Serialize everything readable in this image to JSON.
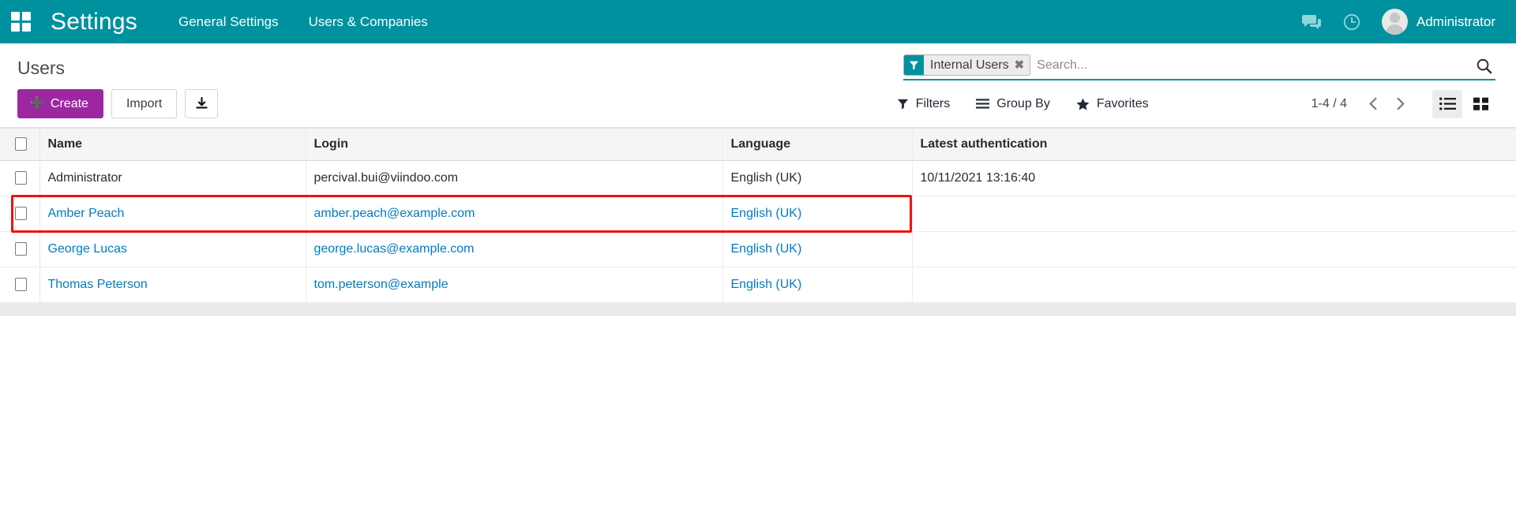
{
  "navbar": {
    "apps_icon": "apps-grid-icon",
    "brand": "Settings",
    "menu": [
      {
        "label": "General Settings"
      },
      {
        "label": "Users & Companies"
      }
    ],
    "messages_icon": "chat-bubble-icon",
    "activities_icon": "clock-icon",
    "username": "Administrator",
    "accent_color": "#00919e"
  },
  "control_panel": {
    "page_title": "Users",
    "search": {
      "facet": {
        "icon": "filter-funnel-icon",
        "label": "Internal Users",
        "remove_label": "✖"
      },
      "placeholder": "Search...",
      "value": "",
      "search_icon": "search-icon",
      "underline_color": "#00919e"
    },
    "buttons": {
      "create": "Create",
      "create_color": "#9c27a0",
      "import": "Import",
      "export_icon": "download-icon"
    },
    "tools": [
      {
        "label": "Filters",
        "icon": "filter-funnel-icon"
      },
      {
        "label": "Group By",
        "icon": "hamburger-icon"
      },
      {
        "label": "Favorites",
        "icon": "star-icon"
      }
    ],
    "pager": {
      "range": "1-4 / 4",
      "prev_icon": "chevron-left-icon",
      "next_icon": "chevron-right-icon"
    },
    "views": [
      {
        "name": "list",
        "icon": "list-view-icon",
        "active": true
      },
      {
        "name": "kanban",
        "icon": "kanban-view-icon",
        "active": false
      }
    ]
  },
  "table": {
    "columns": [
      "Name",
      "Login",
      "Language",
      "Latest authentication"
    ],
    "rows": [
      {
        "name": "Administrator",
        "login": "percival.bui@viindoo.com",
        "language": "English (UK)",
        "latest_authentication": "10/11/2021 13:16:40",
        "is_link": false
      },
      {
        "name": "Amber Peach",
        "login": "amber.peach@example.com",
        "language": "English (UK)",
        "latest_authentication": "",
        "is_link": true
      },
      {
        "name": "George Lucas",
        "login": "george.lucas@example.com",
        "language": "English (UK)",
        "latest_authentication": "",
        "is_link": true
      },
      {
        "name": "Thomas Peterson",
        "login": "tom.peterson@example",
        "language": "English (UK)",
        "latest_authentication": "",
        "is_link": true
      }
    ]
  },
  "annotation": {
    "highlight_color": "#ee1111",
    "highlight_row_index": 1
  }
}
